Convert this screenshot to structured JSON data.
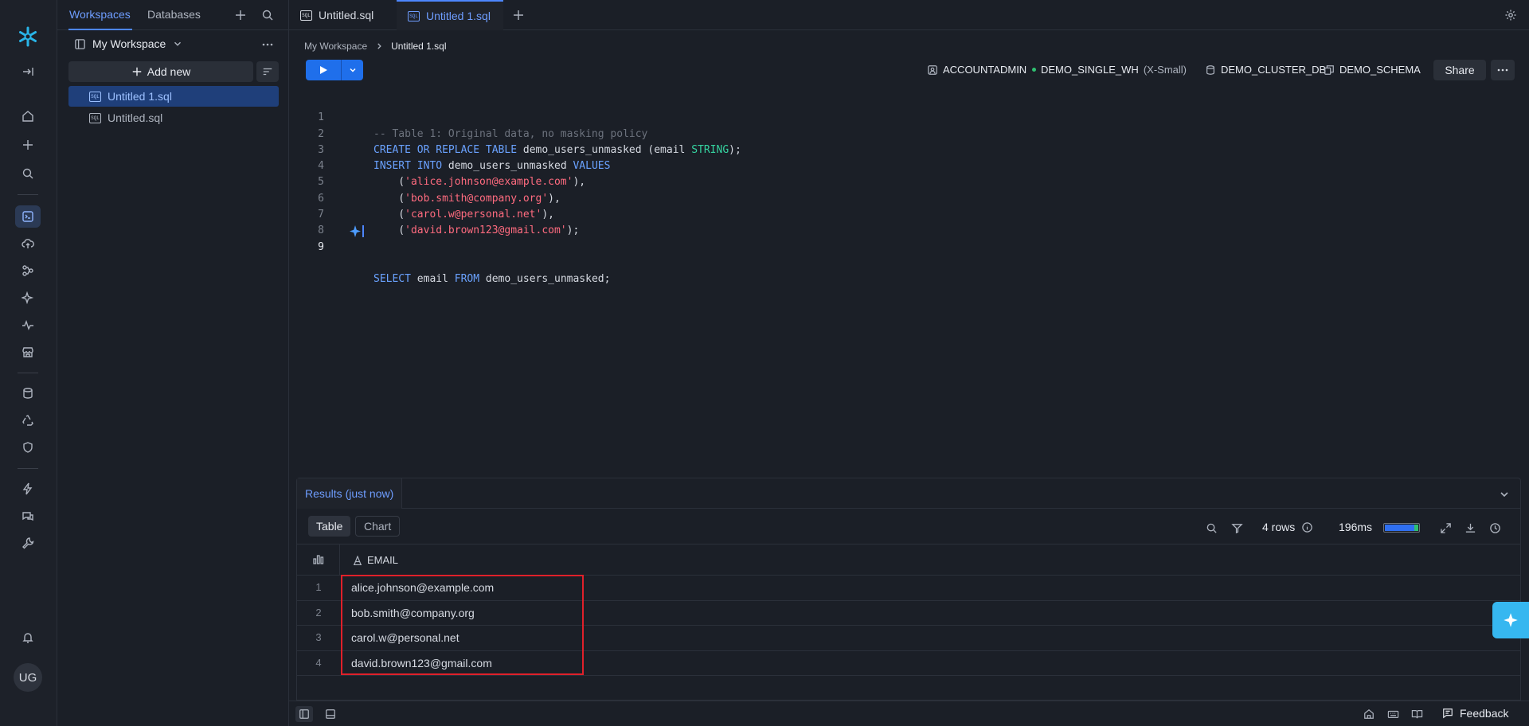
{
  "colors": {
    "accent": "#4d86ff",
    "run_button": "#1f6feb",
    "highlight_box": "#e0202a",
    "keyword": "#6aa2ff",
    "type_keyword": "#35d3a0",
    "string": "#ff6b7f",
    "comment": "#6c727d"
  },
  "rail": {
    "icons": [
      "snowflake-logo",
      "collapse-icon",
      "home-icon",
      "plus-icon",
      "search-icon",
      "worksheets-icon",
      "data-upload-icon",
      "projects-icon",
      "ai-icon",
      "monitoring-icon",
      "marketplace-icon",
      "database-icon",
      "recycle-icon",
      "shield-icon",
      "lightning-icon",
      "data-sharing-icon",
      "admin-icon",
      "bell-icon"
    ],
    "avatar_initials": "UG"
  },
  "panel": {
    "tabs": [
      "Workspaces",
      "Databases"
    ],
    "workspace_title": "My Workspace",
    "add_new_label": "Add new",
    "files": [
      {
        "name": "Untitled 1.sql",
        "active": true
      },
      {
        "name": "Untitled.sql",
        "active": false
      }
    ]
  },
  "editor": {
    "tabs": [
      {
        "label": "Untitled.sql",
        "active": false
      },
      {
        "label": "Untitled 1.sql",
        "active": true
      }
    ],
    "breadcrumb": [
      "My Workspace",
      "Untitled 1.sql"
    ],
    "context": {
      "role": "ACCOUNTADMIN",
      "warehouse": "DEMO_SINGLE_WH",
      "warehouse_size": "(X-Small)",
      "database": "DEMO_CLUSTER_DB",
      "schema": "DEMO_SCHEMA"
    },
    "share_label": "Share",
    "active_line": 9,
    "code_lines": [
      "-- Table 1: Original data, no masking policy",
      "CREATE OR REPLACE TABLE demo_users_unmasked (email STRING);",
      "INSERT INTO demo_users_unmasked VALUES",
      "    ('alice.johnson@example.com'),",
      "    ('bob.smith@company.org'),",
      "    ('carol.w@personal.net'),",
      "    ('david.brown123@gmail.com');",
      "",
      "SELECT email FROM demo_users_unmasked;"
    ]
  },
  "results": {
    "title": "Results (just now)",
    "view_tabs": [
      "Table",
      "Chart"
    ],
    "row_count": "4 rows",
    "duration": "196ms",
    "column": "EMAIL",
    "rows": [
      {
        "n": "1",
        "email": "alice.johnson@example.com"
      },
      {
        "n": "2",
        "email": "bob.smith@company.org"
      },
      {
        "n": "3",
        "email": "carol.w@personal.net"
      },
      {
        "n": "4",
        "email": "david.brown123@gmail.com"
      }
    ]
  },
  "statusbar": {
    "feedback_label": "Feedback"
  }
}
